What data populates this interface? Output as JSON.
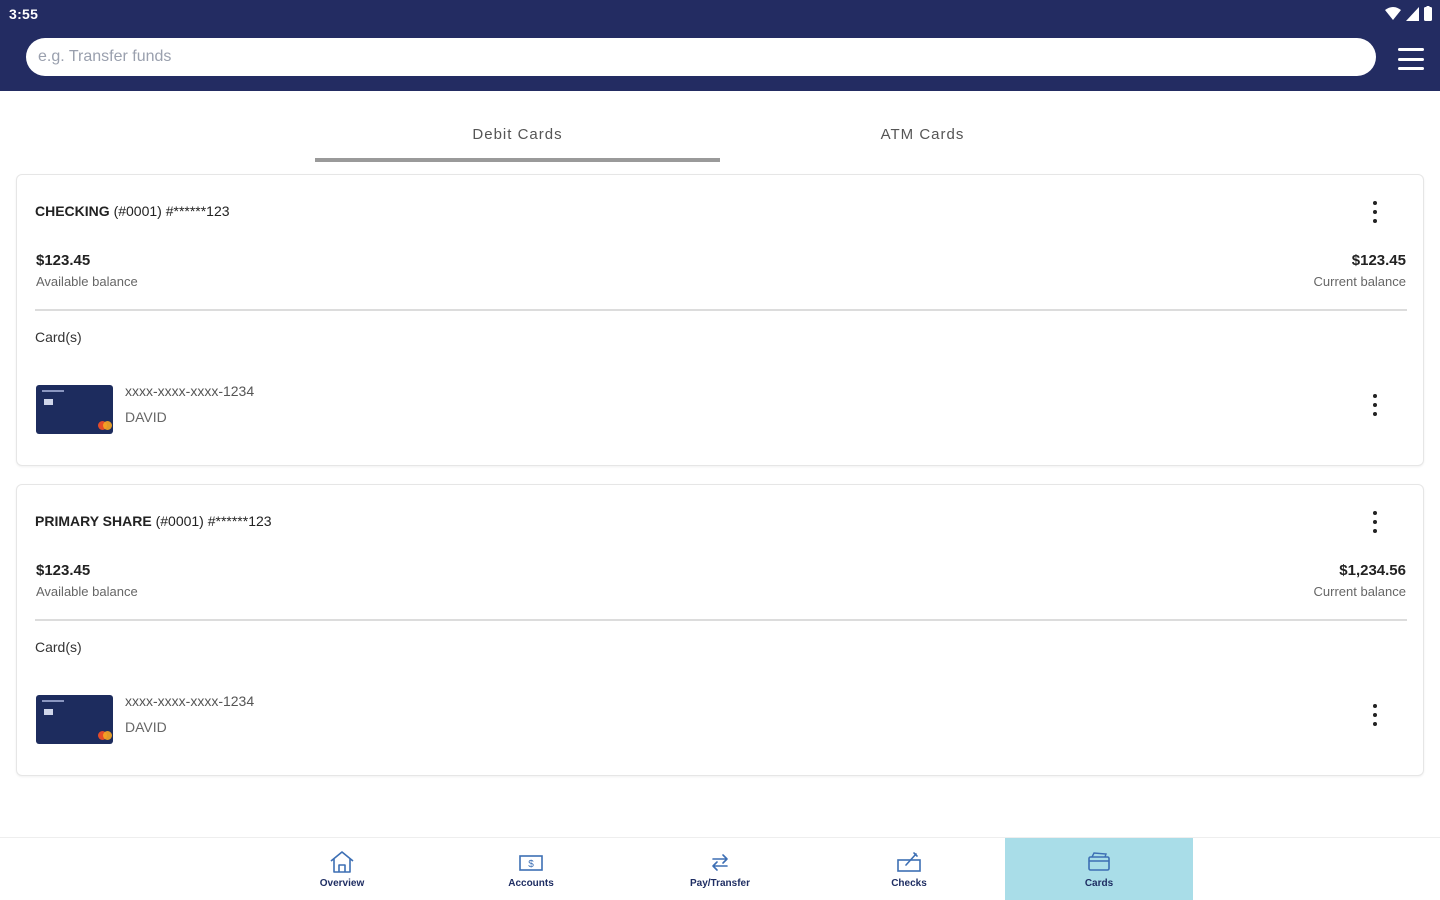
{
  "status_bar": {
    "time": "3:55"
  },
  "search": {
    "placeholder": "e.g. Transfer funds"
  },
  "tabs": [
    {
      "label": "Debit Cards",
      "active": true
    },
    {
      "label": "ATM Cards",
      "active": false
    }
  ],
  "accounts": [
    {
      "name": "CHECKING",
      "suffix": "(#0001) #******123",
      "available_amount": "$123.45",
      "available_label": "Available balance",
      "current_amount": "$123.45",
      "current_label": "Current balance",
      "cards_label": "Card(s)",
      "card": {
        "number": "xxxx-xxxx-xxxx-1234",
        "holder": "DAVID"
      }
    },
    {
      "name": "PRIMARY SHARE",
      "suffix": "(#0001) #******123",
      "available_amount": "$123.45",
      "available_label": "Available balance",
      "current_amount": "$1,234.56",
      "current_label": "Current balance",
      "cards_label": "Card(s)",
      "card": {
        "number": "xxxx-xxxx-xxxx-1234",
        "holder": "DAVID"
      }
    }
  ],
  "bottom_nav": [
    {
      "label": "Overview",
      "icon": "home-icon",
      "active": false
    },
    {
      "label": "Accounts",
      "icon": "accounts-icon",
      "active": false
    },
    {
      "label": "Pay/Transfer",
      "icon": "transfer-icon",
      "active": false
    },
    {
      "label": "Checks",
      "icon": "checks-icon",
      "active": false
    },
    {
      "label": "Cards",
      "icon": "cards-icon",
      "active": true
    }
  ],
  "colors": {
    "header_bg": "#232c62",
    "active_nav_bg": "#a9dde8",
    "nav_icon": "#3d6fb4",
    "card_bg": "#1d2c5e"
  }
}
